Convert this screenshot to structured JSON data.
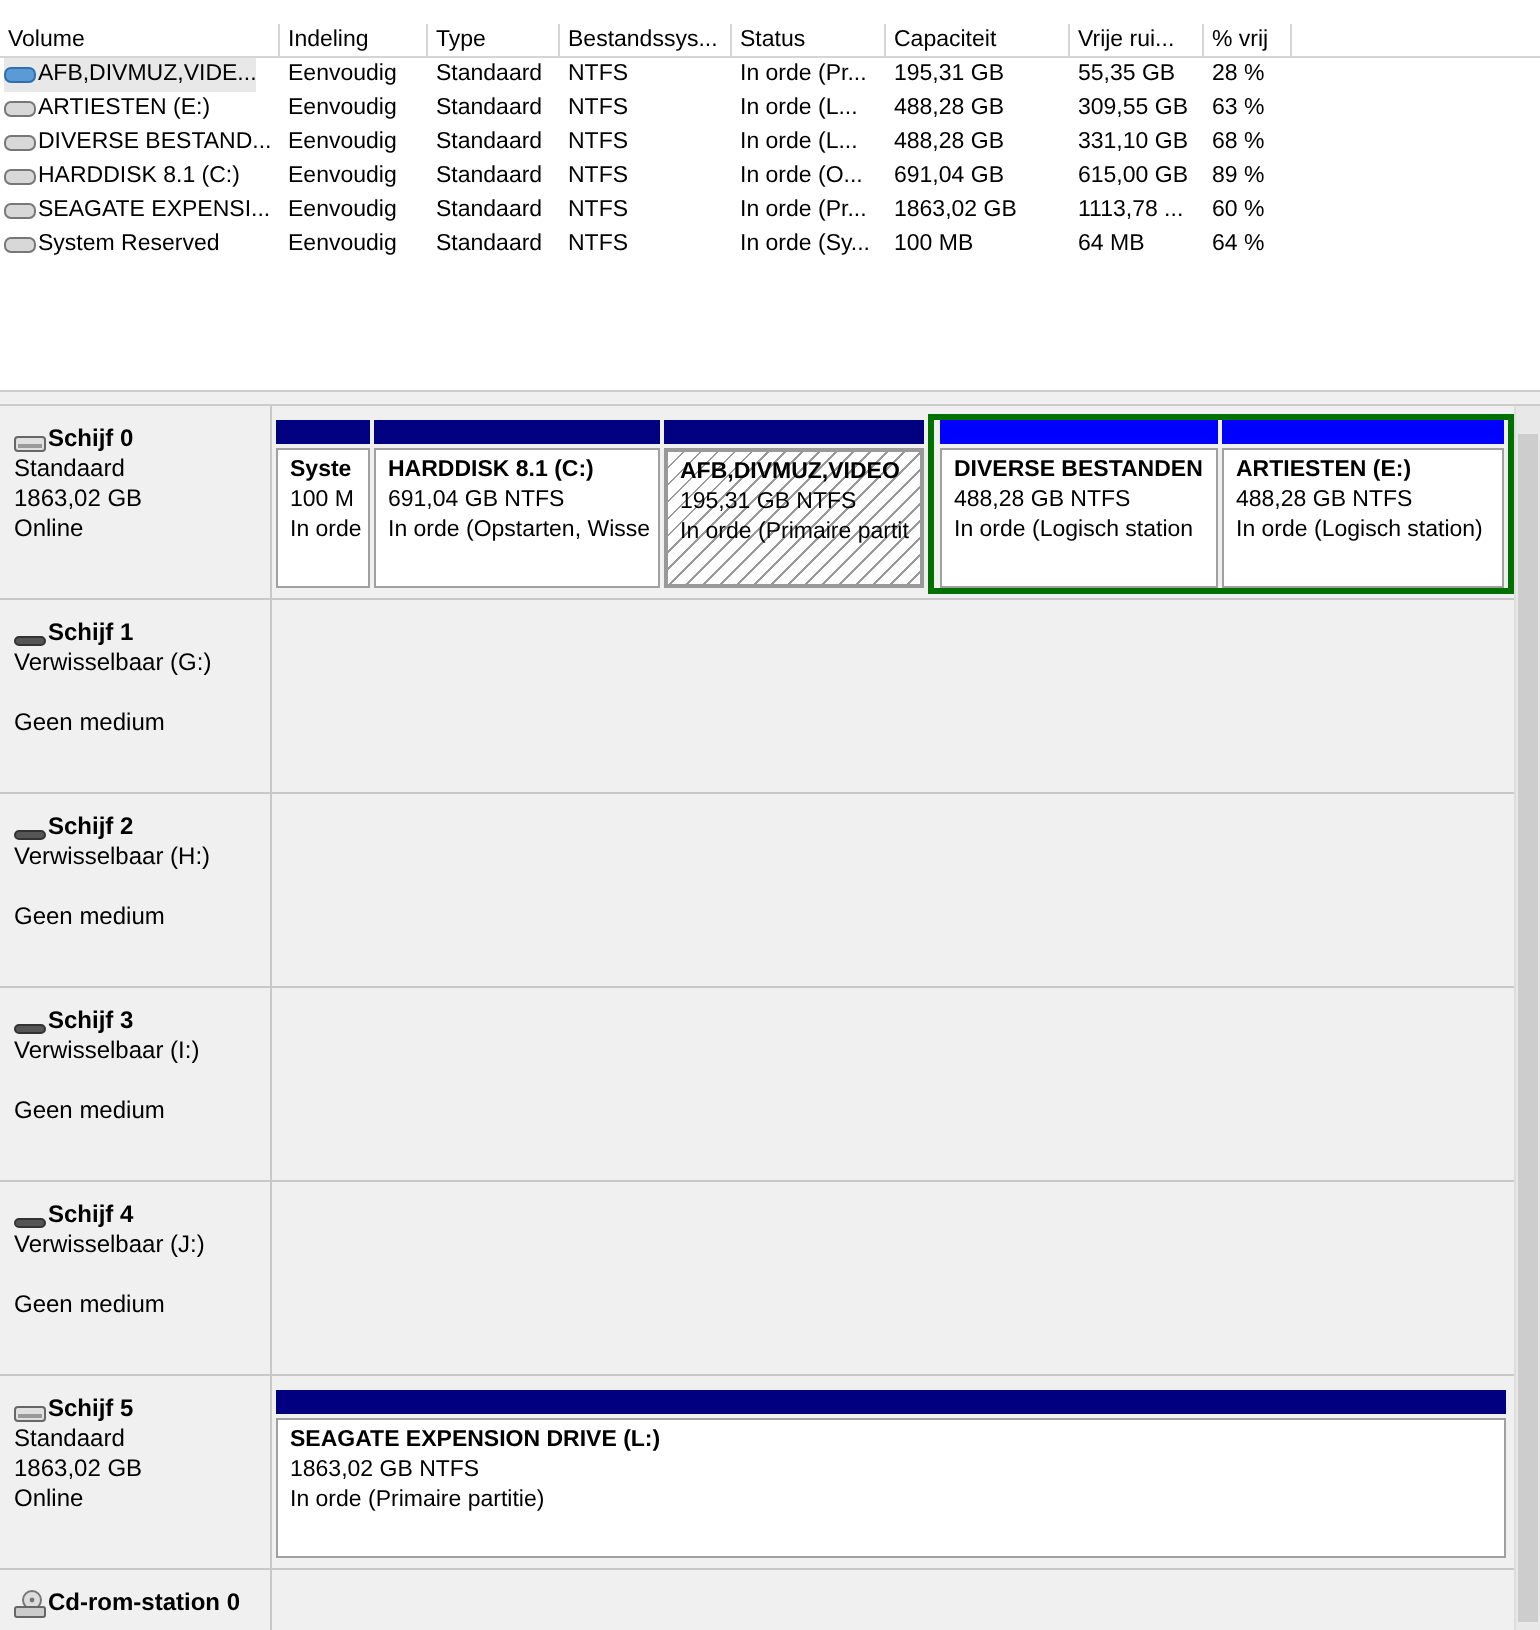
{
  "volume_table": {
    "columns": [
      "Volume",
      "Indeling",
      "Type",
      "Bestandssys...",
      "Status",
      "Capaciteit",
      "Vrije rui...",
      "% vrij"
    ],
    "rows": [
      {
        "selected": true,
        "cells": [
          "AFB,DIVMUZ,VIDE...",
          "Eenvoudig",
          "Standaard",
          "NTFS",
          "In orde (Pr...",
          "195,31 GB",
          "55,35 GB",
          "28 %"
        ]
      },
      {
        "selected": false,
        "cells": [
          "ARTIESTEN (E:)",
          "Eenvoudig",
          "Standaard",
          "NTFS",
          "In orde (L...",
          "488,28 GB",
          "309,55 GB",
          "63 %"
        ]
      },
      {
        "selected": false,
        "cells": [
          "DIVERSE BESTAND...",
          "Eenvoudig",
          "Standaard",
          "NTFS",
          "In orde (L...",
          "488,28 GB",
          "331,10 GB",
          "68 %"
        ]
      },
      {
        "selected": false,
        "cells": [
          "HARDDISK 8.1 (C:)",
          "Eenvoudig",
          "Standaard",
          "NTFS",
          "In orde (O...",
          "691,04 GB",
          "615,00 GB",
          "89 %"
        ]
      },
      {
        "selected": false,
        "cells": [
          "SEAGATE EXPENSI...",
          "Eenvoudig",
          "Standaard",
          "NTFS",
          "In orde (Pr...",
          "1863,02 GB",
          "1113,78 ...",
          "60 %"
        ]
      },
      {
        "selected": false,
        "cells": [
          "System Reserved",
          "Eenvoudig",
          "Standaard",
          "NTFS",
          "In orde (Sy...",
          "100 MB",
          "64 MB",
          "64 %"
        ]
      }
    ]
  },
  "disks": [
    {
      "kind": "disk",
      "name": "Schijf 0",
      "type": "Standaard",
      "size": "1863,02 GB",
      "state": "Online",
      "partitions": [
        {
          "kind": "primary",
          "selected": false,
          "title": "Syste",
          "size": "100 M",
          "status": "In orde"
        },
        {
          "kind": "primary",
          "selected": false,
          "title": "HARDDISK 8.1  (C:)",
          "size": "691,04 GB NTFS",
          "status": "In orde (Opstarten, Wisse"
        },
        {
          "kind": "primary",
          "selected": true,
          "title": "AFB,DIVMUZ,VIDEO",
          "size": "195,31 GB NTFS",
          "status": "In orde (Primaire partit"
        },
        {
          "kind": "logical",
          "selected": false,
          "title": "DIVERSE BESTANDEN",
          "size": "488,28 GB NTFS",
          "status": "In orde (Logisch station"
        },
        {
          "kind": "logical",
          "selected": false,
          "title": "ARTIESTEN  (E:)",
          "size": "488,28 GB NTFS",
          "status": "In orde (Logisch station)"
        }
      ]
    },
    {
      "kind": "removable",
      "name": "Schijf 1",
      "type": "Verwisselbaar (G:)",
      "state": "Geen medium"
    },
    {
      "kind": "removable",
      "name": "Schijf 2",
      "type": "Verwisselbaar (H:)",
      "state": "Geen medium"
    },
    {
      "kind": "removable",
      "name": "Schijf 3",
      "type": "Verwisselbaar (I:)",
      "state": "Geen medium"
    },
    {
      "kind": "removable",
      "name": "Schijf 4",
      "type": "Verwisselbaar (J:)",
      "state": "Geen medium"
    },
    {
      "kind": "disk",
      "name": "Schijf 5",
      "type": "Standaard",
      "size": "1863,02 GB",
      "state": "Online",
      "partitions": [
        {
          "kind": "primary",
          "selected": false,
          "title": "SEAGATE EXPENSION DRIVE  (L:)",
          "size": "1863,02 GB NTFS",
          "status": "In orde (Primaire partitie)"
        }
      ]
    },
    {
      "kind": "cdrom",
      "name": "Cd-rom-station 0"
    }
  ]
}
